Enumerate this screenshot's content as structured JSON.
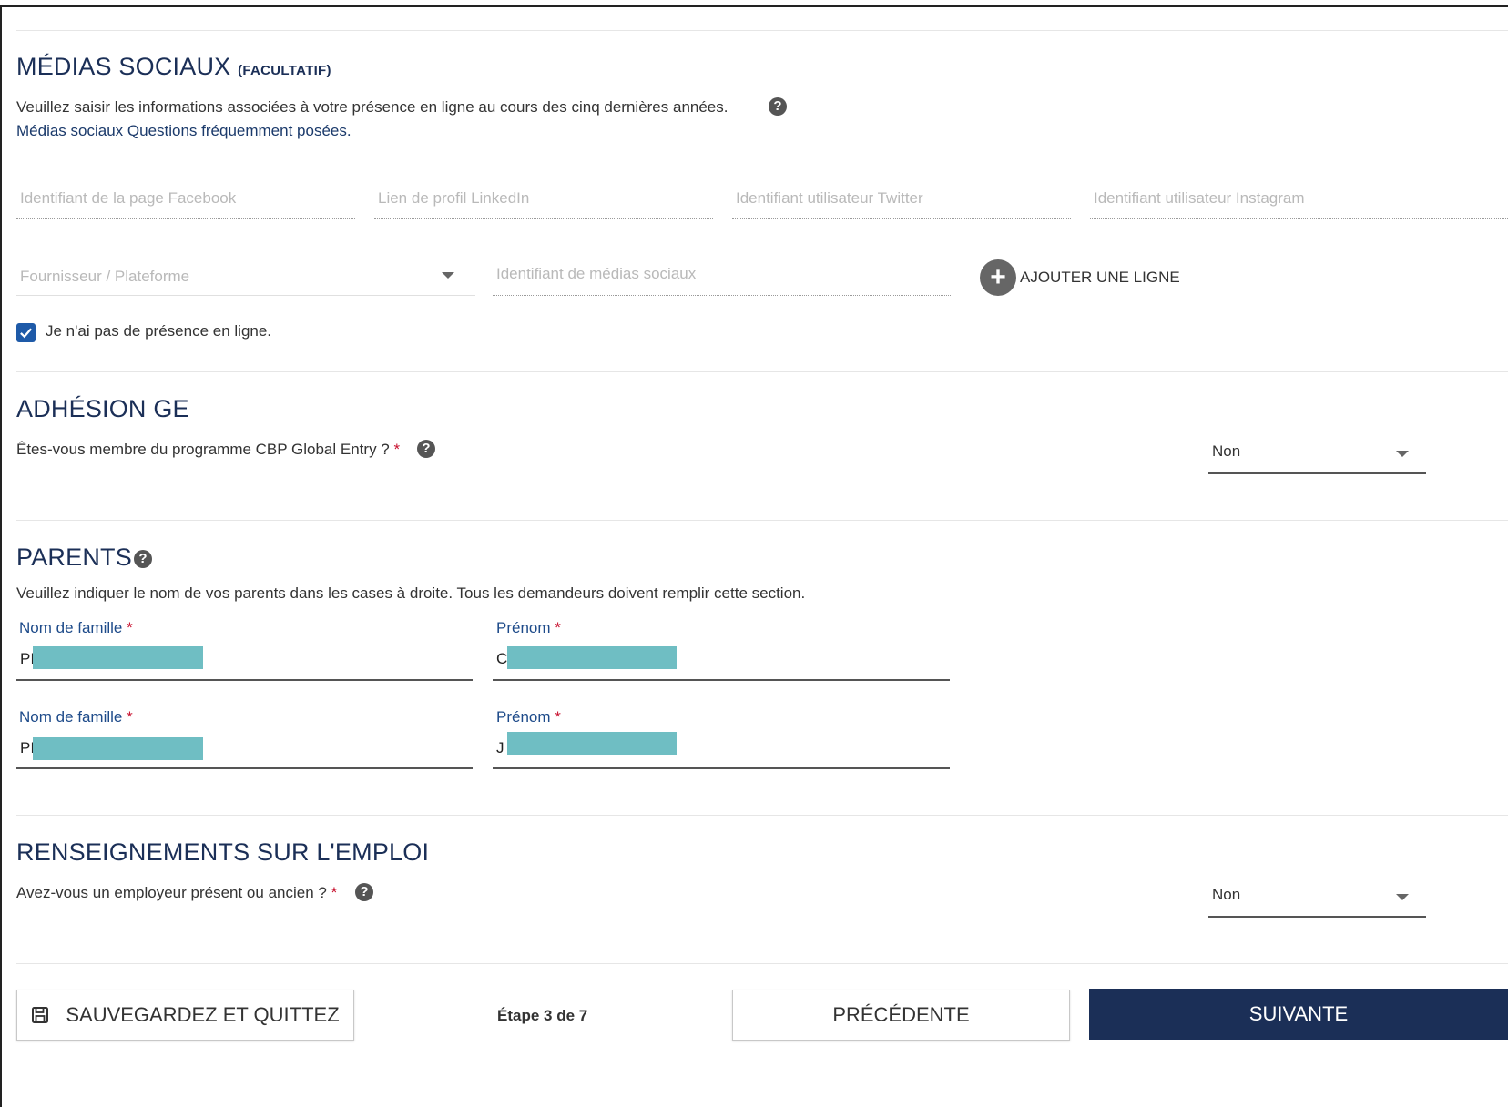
{
  "social": {
    "title": "MÉDIAS SOCIAUX",
    "optional": "(FACULTATIF)",
    "description": "Veuillez saisir les informations associées à votre présence en ligne au cours des cinq dernières années.",
    "faq_link": "Médias sociaux Questions fréquemment posées.",
    "facebook_placeholder": "Identifiant de la page Facebook",
    "linkedin_placeholder": "Lien de profil LinkedIn",
    "twitter_placeholder": "Identifiant utilisateur Twitter",
    "instagram_placeholder": "Identifiant utilisateur Instagram",
    "provider_placeholder": "Fournisseur / Plateforme",
    "social_id_placeholder": "Identifiant de médias sociaux",
    "add_row_label": "AJOUTER UNE LIGNE",
    "no_presence_label": "Je n'ai pas de présence en ligne.",
    "no_presence_checked": true
  },
  "ge": {
    "title": "ADHÉSION GE",
    "question": "Êtes-vous membre du programme CBP Global Entry ?",
    "required_mark": "*",
    "answer": "Non"
  },
  "parents": {
    "title": "PARENTS",
    "description": "Veuillez indiquer le nom de vos parents dans les cases à droite. Tous les demandeurs doivent remplir cette section.",
    "last_name_label": "Nom de famille",
    "first_name_label": "Prénom",
    "required_mark": "*",
    "rows": [
      {
        "last_name": "PI",
        "first_name": "C"
      },
      {
        "last_name": "PI",
        "first_name": "J"
      }
    ]
  },
  "employment": {
    "title": "RENSEIGNEMENTS SUR L'EMPLOI",
    "question": "Avez-vous un employeur présent ou ancien ?",
    "required_mark": "*",
    "answer": "Non"
  },
  "footer": {
    "save_label": "SAUVEGARDEZ ET QUITTEZ",
    "step_label": "Étape 3 de 7",
    "prev_label": "PRÉCÉDENTE",
    "next_label": "SUIVANTE"
  },
  "colors": {
    "heading": "#1b2f57",
    "primary_button": "#1b2f57",
    "required": "#c8102e",
    "checkbox": "#1e5aa8",
    "redaction": "#6fbec3"
  }
}
